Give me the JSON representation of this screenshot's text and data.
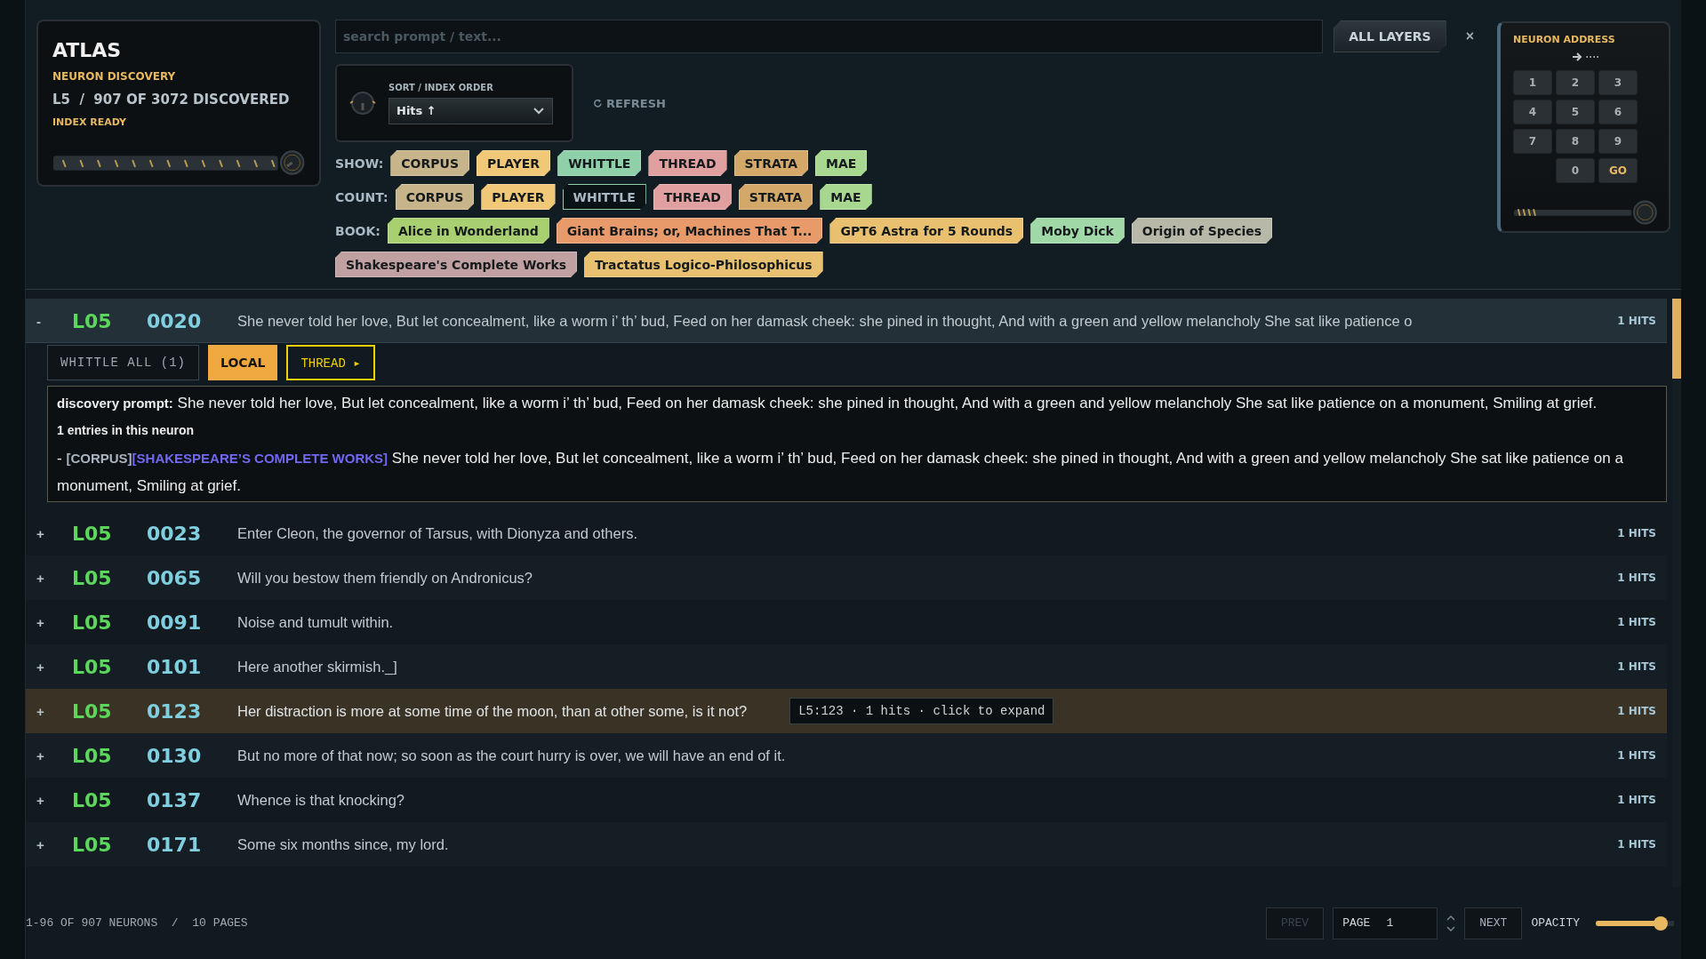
{
  "brand": {
    "title": "ATLAS",
    "subtitle": "NEURON DISCOVERY",
    "status_line": "L5  /  907 OF 3072 DISCOVERED",
    "index_status": "INDEX READY"
  },
  "search": {
    "placeholder": "search prompt / text..."
  },
  "layer_button": "ALL LAYERS",
  "clear_button": "×",
  "sort": {
    "label": "SORT / INDEX ORDER",
    "value": "Hits ↑"
  },
  "refresh_button": "REFRESH",
  "filters": [
    {
      "label": "SHOW:",
      "chips": [
        {
          "text": "CORPUS",
          "color": "#c8b48a",
          "on": true
        },
        {
          "text": "PLAYER",
          "color": "#f0c878",
          "on": true
        },
        {
          "text": "WHITTLE",
          "color": "#8fd0a8",
          "on": true
        },
        {
          "text": "THREAD",
          "color": "#e0a0a0",
          "on": true
        },
        {
          "text": "STRATA",
          "color": "#d4a868",
          "on": true
        },
        {
          "text": "MAE",
          "color": "#a8d890",
          "on": true
        }
      ]
    },
    {
      "label": "COUNT:",
      "chips": [
        {
          "text": "CORPUS",
          "color": "#c8b48a",
          "on": true
        },
        {
          "text": "PLAYER",
          "color": "#f0c878",
          "on": true
        },
        {
          "text": "WHITTLE",
          "color": "#8fd0a8",
          "on": false
        },
        {
          "text": "THREAD",
          "color": "#e0a0a0",
          "on": true
        },
        {
          "text": "STRATA",
          "color": "#d4a868",
          "on": true
        },
        {
          "text": "MAE",
          "color": "#a8d890",
          "on": true
        }
      ]
    },
    {
      "label": "BOOK:",
      "chips": [
        {
          "text": "Alice in Wonderland",
          "color": "#a8d070",
          "on": true
        },
        {
          "text": "Giant Brains; or, Machines That T...",
          "color": "#e89a6a",
          "on": true
        },
        {
          "text": "GPT6 Astra for 5 Rounds",
          "color": "#e8c070",
          "on": true
        },
        {
          "text": "Moby Dick",
          "color": "#a0d8a8",
          "on": true
        },
        {
          "text": "Origin of Species",
          "color": "#b8b8a8",
          "on": true
        },
        {
          "text": "Shakespeare's Complete Works",
          "color": "#c0a0a0",
          "on": true
        },
        {
          "text": "Tractatus Logico-Philosophicus",
          "color": "#e8c070",
          "on": true
        }
      ]
    }
  ],
  "keypad": {
    "title": "NEURON ADDRESS",
    "display": "····",
    "keys": [
      {
        "label": "1",
        "kind": "digit"
      },
      {
        "label": "2",
        "kind": "digit"
      },
      {
        "label": "3",
        "kind": "digit"
      },
      {
        "label": "4",
        "kind": "digit"
      },
      {
        "label": "5",
        "kind": "digit"
      },
      {
        "label": "6",
        "kind": "digit"
      },
      {
        "label": "7",
        "kind": "digit"
      },
      {
        "label": "8",
        "kind": "digit"
      },
      {
        "label": "9",
        "kind": "digit"
      },
      {
        "label": "0",
        "kind": "digit"
      },
      {
        "label": "GO",
        "kind": "go"
      }
    ]
  },
  "neurons": [
    {
      "toggle": "-",
      "layer": "L05",
      "index": "0020",
      "text": "She never told her love, But let concealment, like a worm i’ th’ bud, Feed on her damask cheek: she pined in thought, And with a green and yellow melancholy She sat like patience o",
      "hits": "1 HITS",
      "expanded": true,
      "hovered": false,
      "details": {
        "actions": [
          {
            "text": "WHITTLE ALL (1)",
            "kind": "outline"
          },
          {
            "text": "LOCAL",
            "kind": "solid"
          },
          {
            "text": "THREAD ▸",
            "kind": "accent"
          }
        ],
        "prompt": "**discovery prompt:** She never told her love, But let concealment, like a worm i’ th’ bud, Feed on her damask cheek: she pined in thought, And with a green and yellow melancholy She sat like patience on a monument, Smiling at grief.",
        "count": "1 entries in this neuron",
        "entries": [
          {
            "prefix": "- ",
            "source": "[CORPUS]",
            "book": "[SHAKESPEARE’S COMPLETE WORKS]",
            "text": "She never told her love, But let concealment, like a worm i’ th’ bud, Feed on her damask cheek: she pined in thought, And with a green and yellow melancholy She sat like patience on a monument, Smiling at grief."
          }
        ]
      }
    },
    {
      "toggle": "+",
      "layer": "L05",
      "index": "0023",
      "text": "Enter Cleon, the governor of Tarsus, with Dionyza and others.",
      "hits": "1 HITS",
      "expanded": false,
      "hovered": false
    },
    {
      "toggle": "+",
      "layer": "L05",
      "index": "0065",
      "text": "Will you bestow them friendly on Andronicus?",
      "hits": "1 HITS",
      "expanded": false,
      "hovered": false
    },
    {
      "toggle": "+",
      "layer": "L05",
      "index": "0091",
      "text": "Noise and tumult within.",
      "hits": "1 HITS",
      "expanded": false,
      "hovered": false
    },
    {
      "toggle": "+",
      "layer": "L05",
      "index": "0101",
      "text": "Here another skirmish._]",
      "hits": "1 HITS",
      "expanded": false,
      "hovered": false
    },
    {
      "toggle": "+",
      "layer": "L05",
      "index": "0123",
      "text": "Her distraction is more at some time of the moon, than at other some, is it not?",
      "hits": "1 HITS",
      "expanded": false,
      "hovered": true,
      "tooltip": "L5:123 · 1 hits · click to expand"
    },
    {
      "toggle": "+",
      "layer": "L05",
      "index": "0130",
      "text": "But no more of that now; so soon as the court hurry is over, we will have an end of it.",
      "hits": "1 HITS",
      "expanded": false,
      "hovered": false
    },
    {
      "toggle": "+",
      "layer": "L05",
      "index": "0137",
      "text": "Whence is that knocking?",
      "hits": "1 HITS",
      "expanded": false,
      "hovered": false
    },
    {
      "toggle": "+",
      "layer": "L05",
      "index": "0171",
      "text": "Some six months since, my lord.",
      "hits": "1 HITS",
      "expanded": false,
      "hovered": false
    }
  ],
  "footer": {
    "summary": "1-96 OF 907 NEURONS  /  10 PAGES",
    "prev": {
      "text": "PREV",
      "disabled": true
    },
    "page_label": "PAGE",
    "page_value": "1",
    "next": {
      "text": "NEXT",
      "disabled": false
    },
    "opacity_label": "OPACITY",
    "opacity": {
      "level": 0.9
    }
  }
}
